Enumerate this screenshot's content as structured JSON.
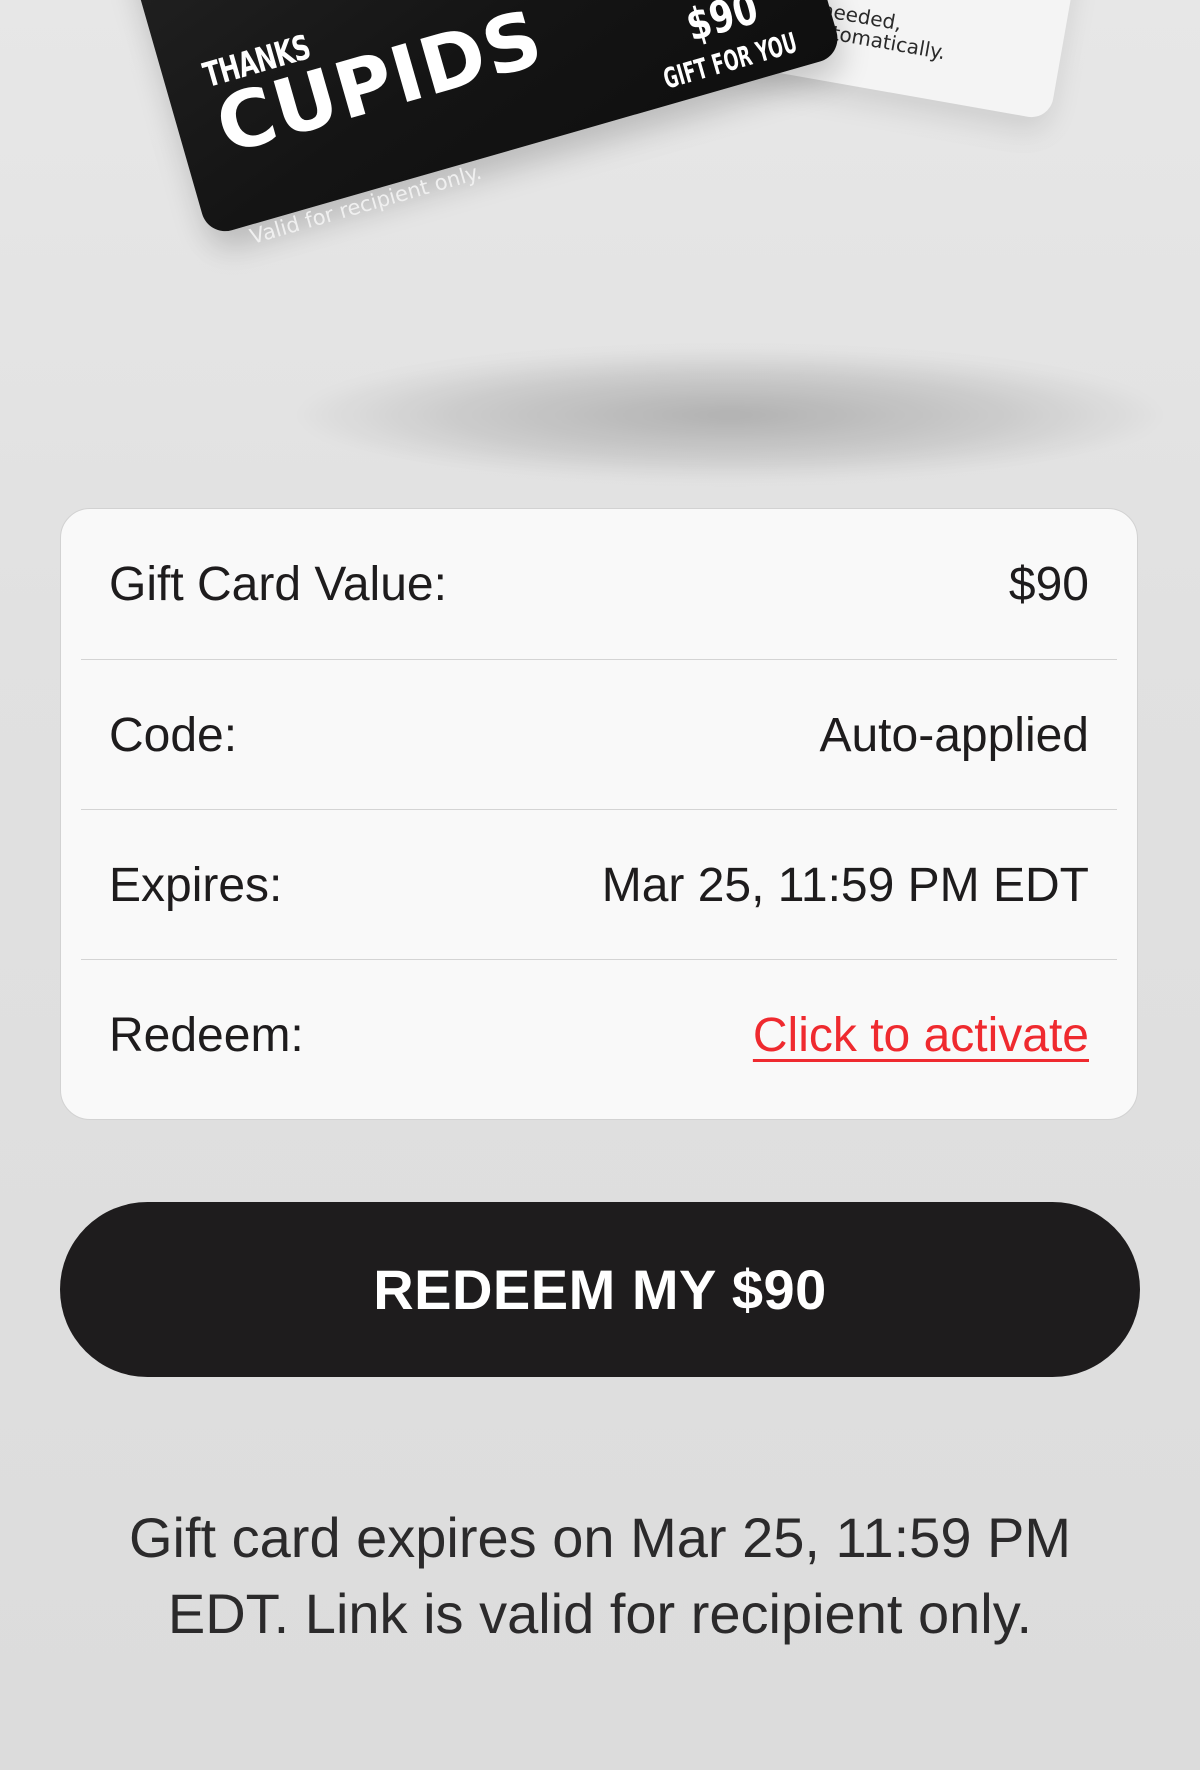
{
  "hero": {
    "black_card": {
      "thanks": "THANKS",
      "brand": "CUPIDS",
      "amount": "$90",
      "gift_label": "GIFT FOR YOU",
      "valid_note": "Valid for recipient only."
    },
    "white_card": {
      "note_line_1": "No code needed,",
      "note_line_2": "applies automatically."
    }
  },
  "details": {
    "rows": [
      {
        "label": "Gift Card Value:",
        "value": "$90"
      },
      {
        "label": "Code:",
        "value": "Auto-applied"
      },
      {
        "label": "Expires:",
        "value": "Mar 25, 11:59 PM EDT"
      },
      {
        "label": "Redeem:",
        "value": "Click to activate"
      }
    ]
  },
  "redeem_button": {
    "label": "REDEEM MY $90"
  },
  "footer": {
    "line_1": "Gift card expires on Mar 25, 11:59 PM",
    "line_2": "EDT. Link is valid for recipient only."
  },
  "colors": {
    "background": "#e1e1e1",
    "card_black": "#1e1c1d",
    "link_red": "#ef2a2f",
    "panel": "#f9f9f9"
  }
}
